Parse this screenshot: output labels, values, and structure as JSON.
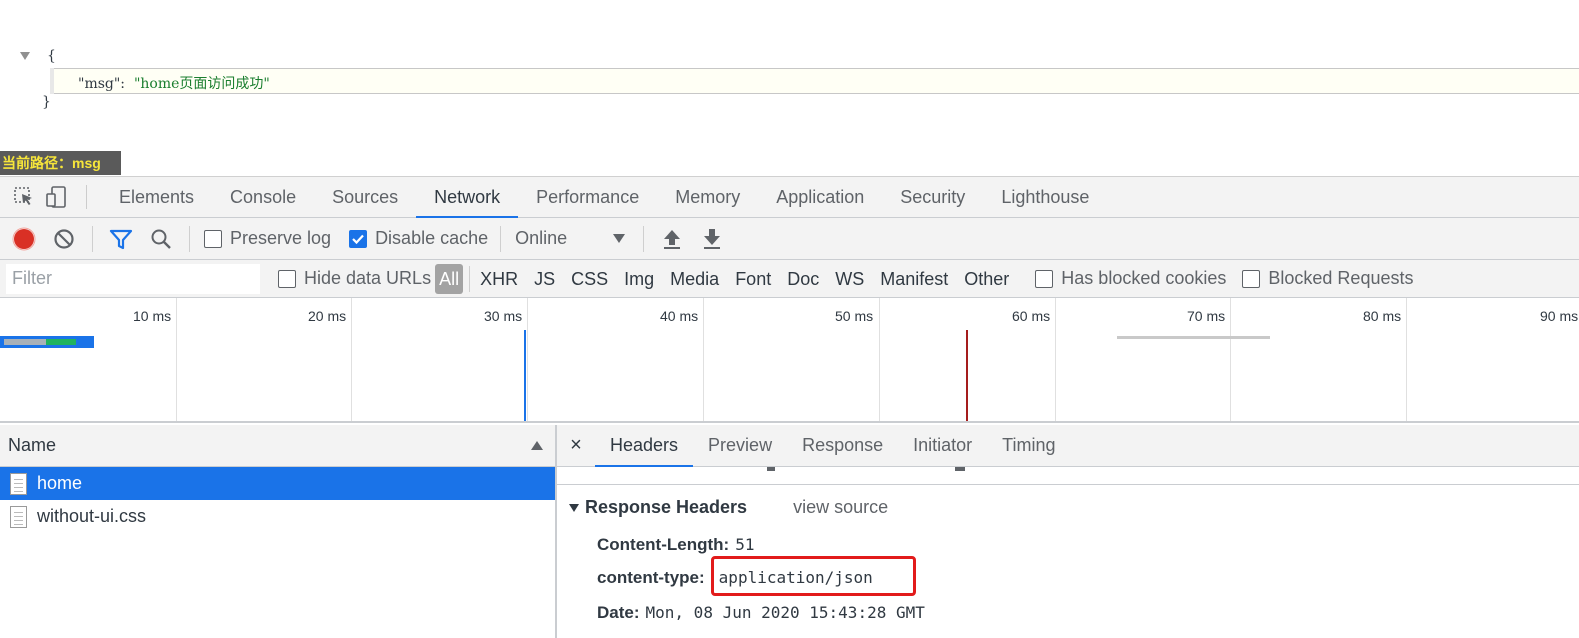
{
  "json_view": {
    "open_brace": "{",
    "close_brace": "}",
    "key": "\"msg\":",
    "value": "\"home页面访问成功\""
  },
  "path_badge": "当前路径：msg",
  "devtools": {
    "tabs": [
      "Elements",
      "Console",
      "Sources",
      "Network",
      "Performance",
      "Memory",
      "Application",
      "Security",
      "Lighthouse"
    ],
    "active_tab": "Network"
  },
  "toolbar": {
    "preserve_log_label": "Preserve log",
    "preserve_log_checked": false,
    "disable_cache_label": "Disable cache",
    "disable_cache_checked": true,
    "throttling_value": "Online"
  },
  "filter_bar": {
    "filter_placeholder": "Filter",
    "hide_data_urls_label": "Hide data URLs",
    "types": [
      "All",
      "XHR",
      "JS",
      "CSS",
      "Img",
      "Media",
      "Font",
      "Doc",
      "WS",
      "Manifest",
      "Other"
    ],
    "active_type": "All",
    "has_blocked_cookies_label": "Has blocked cookies",
    "blocked_requests_label": "Blocked Requests"
  },
  "timeline": {
    "ticks": [
      "10 ms",
      "20 ms",
      "30 ms",
      "40 ms",
      "50 ms",
      "60 ms",
      "70 ms",
      "80 ms",
      "90 ms"
    ],
    "colors": {
      "bar": "#1a73e8",
      "waiting": "#a8b1b8",
      "receiving": "#1fb35f",
      "dom_content_loaded": "#1a73e8",
      "load": "#a51d1d"
    }
  },
  "requests": {
    "column_name": "Name",
    "rows": [
      {
        "name": "home",
        "selected": true
      },
      {
        "name": "without-ui.css",
        "selected": false
      }
    ]
  },
  "details": {
    "close_glyph": "×",
    "tabs": [
      "Headers",
      "Preview",
      "Response",
      "Initiator",
      "Timing"
    ],
    "active_tab": "Headers",
    "section_title": "Response Headers",
    "view_source_label": "view source",
    "headers": [
      {
        "name": "Content-Length:",
        "value": "51"
      },
      {
        "name": "content-type:",
        "value": "application/json"
      },
      {
        "name": "Date:",
        "value": "Mon, 08 Jun 2020 15:43:28 GMT"
      }
    ],
    "highlight_color": "#e21b1b"
  }
}
